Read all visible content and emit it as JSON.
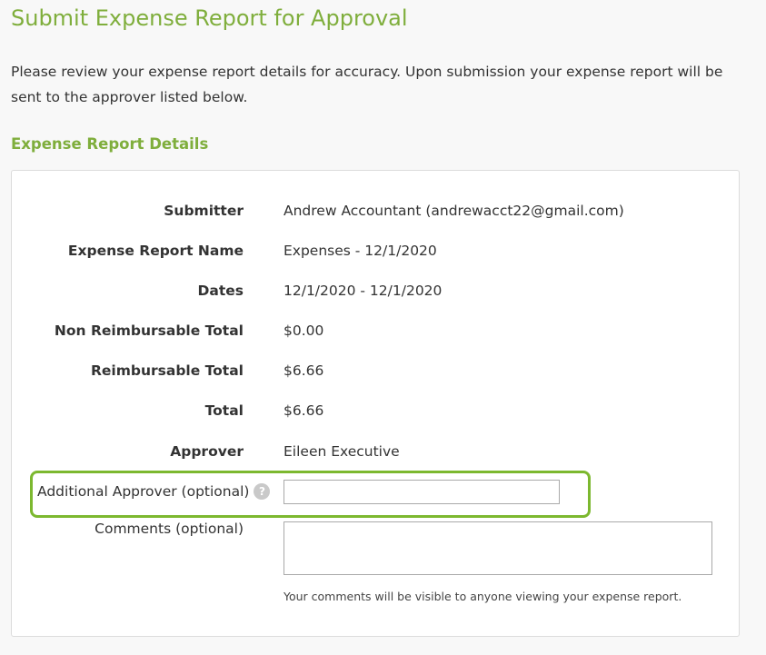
{
  "page": {
    "title": "Submit Expense Report for Approval",
    "intro": "Please review your expense report details for accuracy. Upon submission your expense report will be sent to the approver listed below."
  },
  "section": {
    "title": "Expense Report Details"
  },
  "details": {
    "submitter_label": "Submitter",
    "submitter_value": "Andrew Accountant (andrewacct22@gmail.com)",
    "report_name_label": "Expense Report Name",
    "report_name_value": "Expenses - 12/1/2020",
    "dates_label": "Dates",
    "dates_value": "12/1/2020 - 12/1/2020",
    "non_reimbursable_label": "Non Reimbursable Total",
    "non_reimbursable_value": "$0.00",
    "reimbursable_label": "Reimbursable Total",
    "reimbursable_value": "$6.66",
    "total_label": "Total",
    "total_value": "$6.66",
    "approver_label": "Approver",
    "approver_value": "Eileen Executive"
  },
  "form": {
    "additional_approver_label": "Additional Approver (optional)",
    "additional_approver_value": "",
    "help_icon_glyph": "?",
    "comments_label": "Comments (optional)",
    "comments_value": "",
    "comments_help": "Your comments will be visible to anyone viewing your expense report."
  },
  "colors": {
    "accent": "#7fae3c",
    "highlight_border": "#7cb82f"
  }
}
